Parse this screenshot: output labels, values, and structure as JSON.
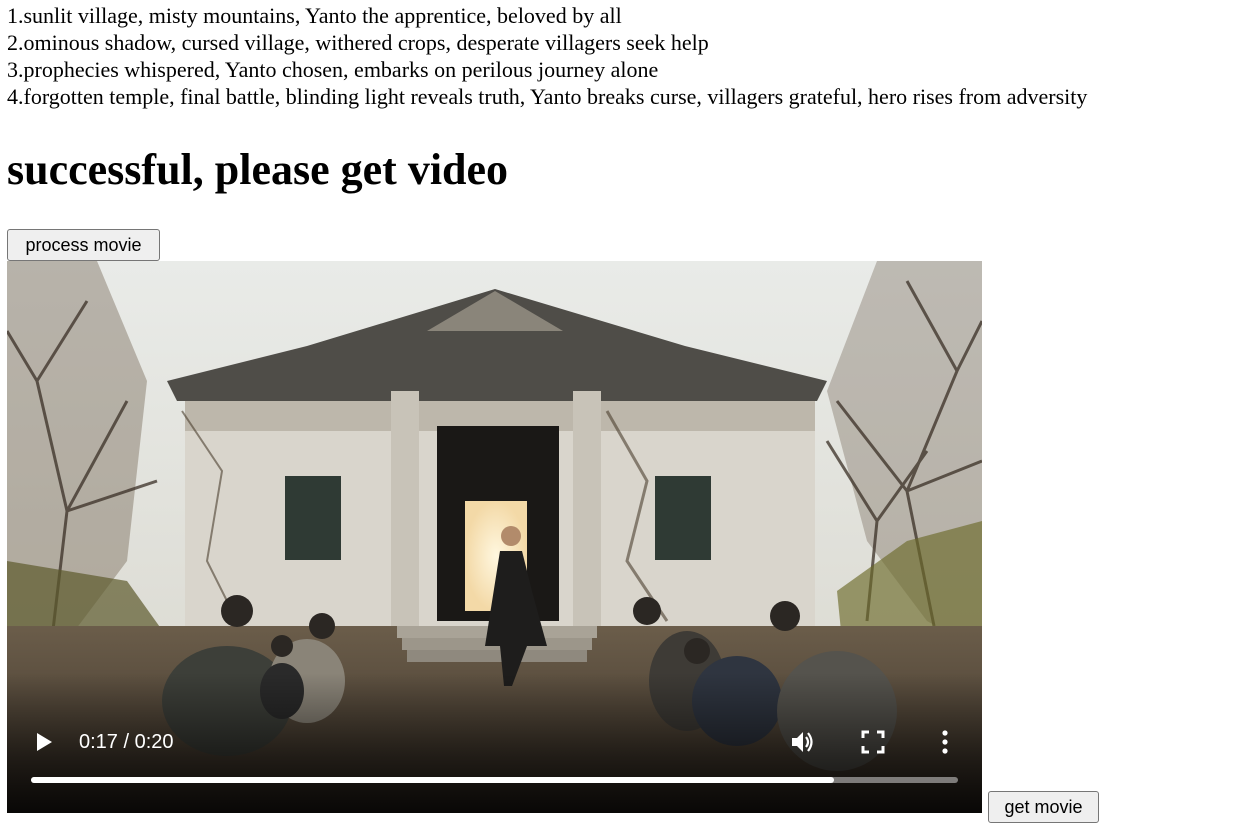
{
  "scenes": [
    "1.sunlit village, misty mountains, Yanto the apprentice, beloved by all",
    "2.ominous shadow, cursed village, withered crops, desperate villagers seek help",
    "3.prophecies whispered, Yanto chosen, embarks on perilous journey alone",
    "4.forgotten temple, final battle, blinding light reveals truth, Yanto breaks curse, villagers grateful, hero rises from adversity"
  ],
  "status": {
    "heading": "successful, please get video"
  },
  "buttons": {
    "process_label": "process movie",
    "get_label": "get movie"
  },
  "video": {
    "time_display": "0:17 / 0:20",
    "progress_fraction": 0.866,
    "icons": {
      "play": "play-icon",
      "volume": "volume-icon",
      "fullscreen": "fullscreen-icon",
      "menu": "more-options-icon"
    }
  },
  "colors": {
    "button_bg": "#efefef",
    "button_border": "#767676",
    "video_bg": "#000000",
    "control_fg": "#ffffff"
  }
}
